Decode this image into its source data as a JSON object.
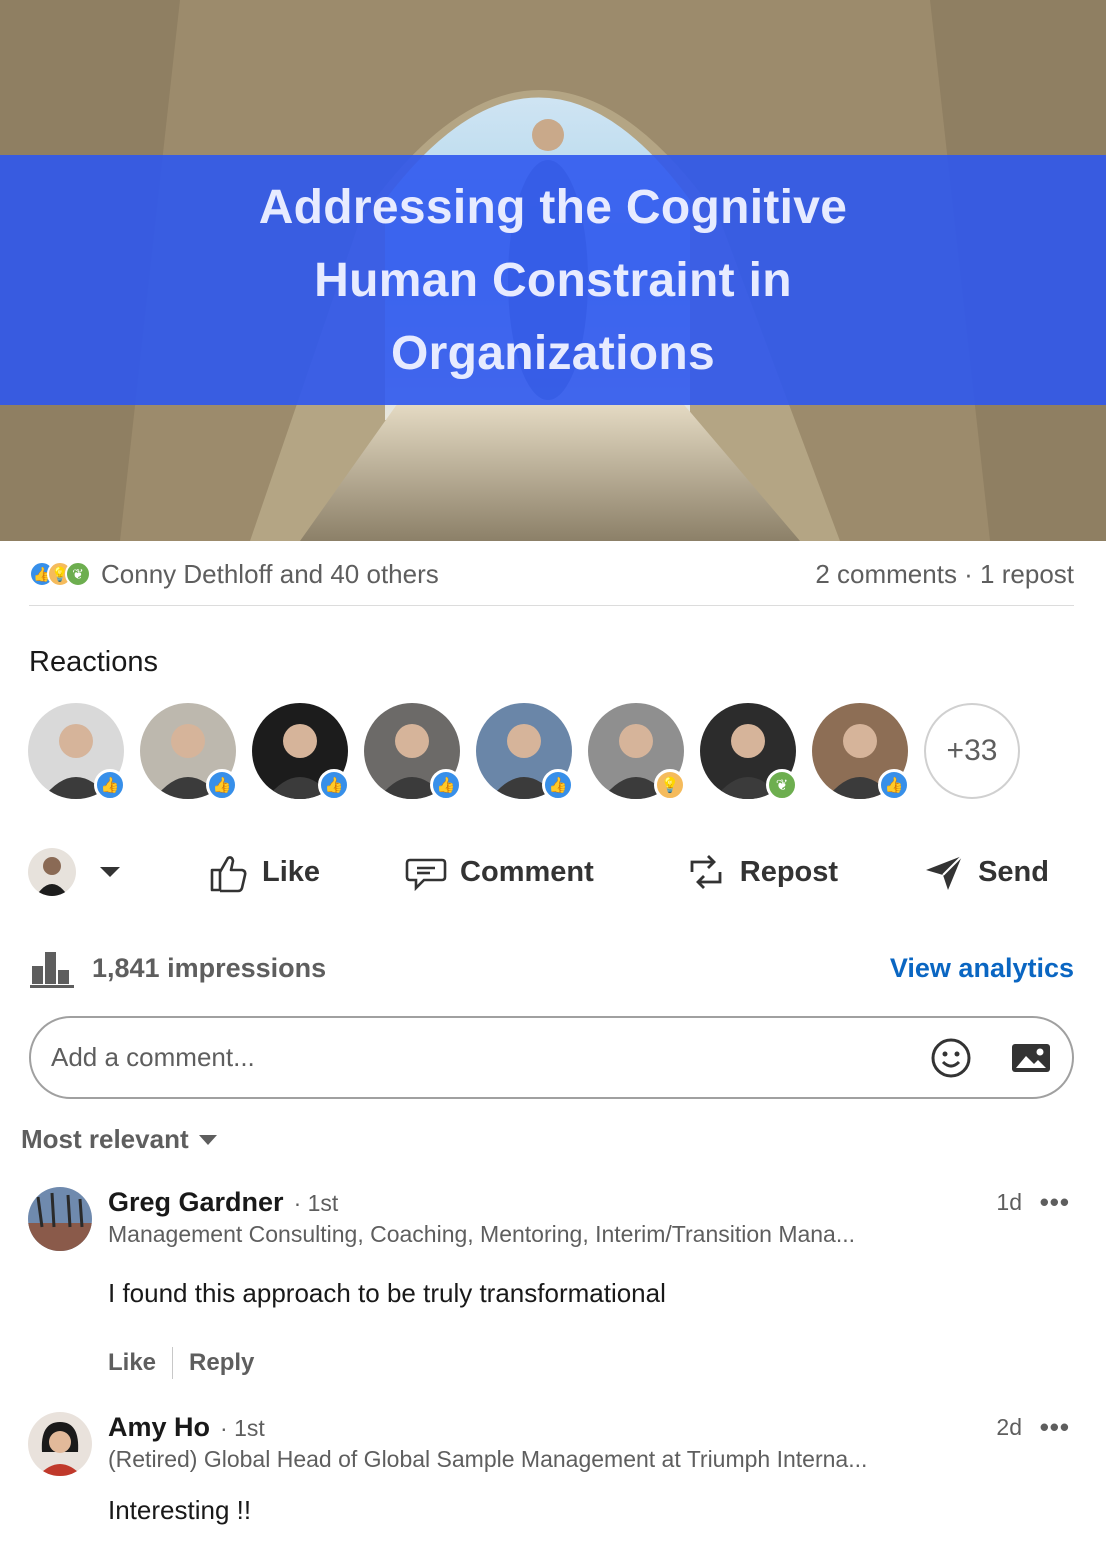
{
  "hero": {
    "title": "Addressing the Cognitive Human Constraint in Organizations"
  },
  "social": {
    "reactors_summary": "Conny Dethloff and 40 others",
    "comments_reposts": "2 comments · 1 repost",
    "reaction_icons": [
      "like-icon",
      "insightful-icon",
      "support-icon"
    ]
  },
  "reactions": {
    "heading": "Reactions",
    "people": [
      {
        "badge": "like",
        "bg": "#d9d9d9"
      },
      {
        "badge": "like",
        "bg": "#bdb8ae"
      },
      {
        "badge": "like",
        "bg": "#1c1c1c"
      },
      {
        "badge": "like",
        "bg": "#6c6a68"
      },
      {
        "badge": "like",
        "bg": "#6a86a8"
      },
      {
        "badge": "insight",
        "bg": "#8f8f8f"
      },
      {
        "badge": "support",
        "bg": "#2c2c2c"
      },
      {
        "badge": "like",
        "bg": "#8d6e55"
      }
    ],
    "more_count": "+33"
  },
  "actions": {
    "like": "Like",
    "comment": "Comment",
    "repost": "Repost",
    "send": "Send"
  },
  "impressions": {
    "text": "1,841 impressions",
    "link": "View analytics"
  },
  "comment_box": {
    "placeholder": "Add a comment..."
  },
  "sort": {
    "label": "Most relevant"
  },
  "comments": [
    {
      "name": "Greg Gardner",
      "degree": "· 1st",
      "headline": "Management Consulting, Coaching, Mentoring, Interim/Transition Mana...",
      "time": "1d",
      "more": "•••",
      "text": "I found this approach to be truly transformational",
      "like": "Like",
      "reply": "Reply"
    },
    {
      "name": "Amy Ho",
      "degree": "· 1st",
      "headline": "(Retired) Global Head of Global Sample Management at Triumph Interna...",
      "time": "2d",
      "more": "•••",
      "text": "Interesting !!"
    }
  ],
  "colors": {
    "banner": "#2f58ee",
    "link": "#0a66c2",
    "like_badge": "#378fe9",
    "insight_badge": "#f5bb5c",
    "support_badge": "#6dae4f"
  }
}
